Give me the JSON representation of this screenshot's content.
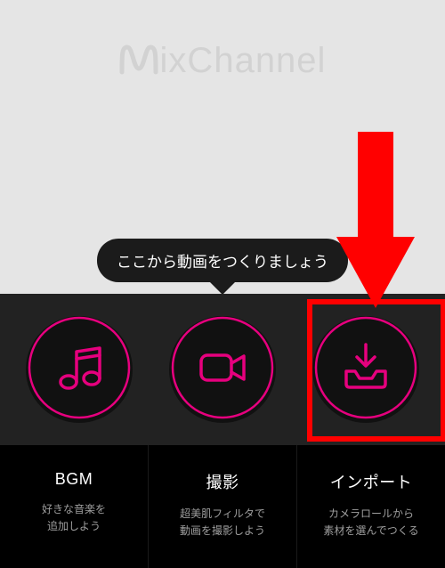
{
  "brand": {
    "name": "ixChannel"
  },
  "tooltip": {
    "text": "ここから動画をつくりましょう"
  },
  "buttons": {
    "bgm": {
      "title": "BGM",
      "subtitle": "好きな音楽を\n追加しよう"
    },
    "record": {
      "title": "撮影",
      "subtitle": "超美肌フィルタで\n動画を撮影しよう"
    },
    "import": {
      "title": "インポート",
      "subtitle": "カメラロールから\n素材を選んでつくる"
    }
  },
  "colors": {
    "accent": "#e6007e",
    "highlight": "#ff0000"
  }
}
